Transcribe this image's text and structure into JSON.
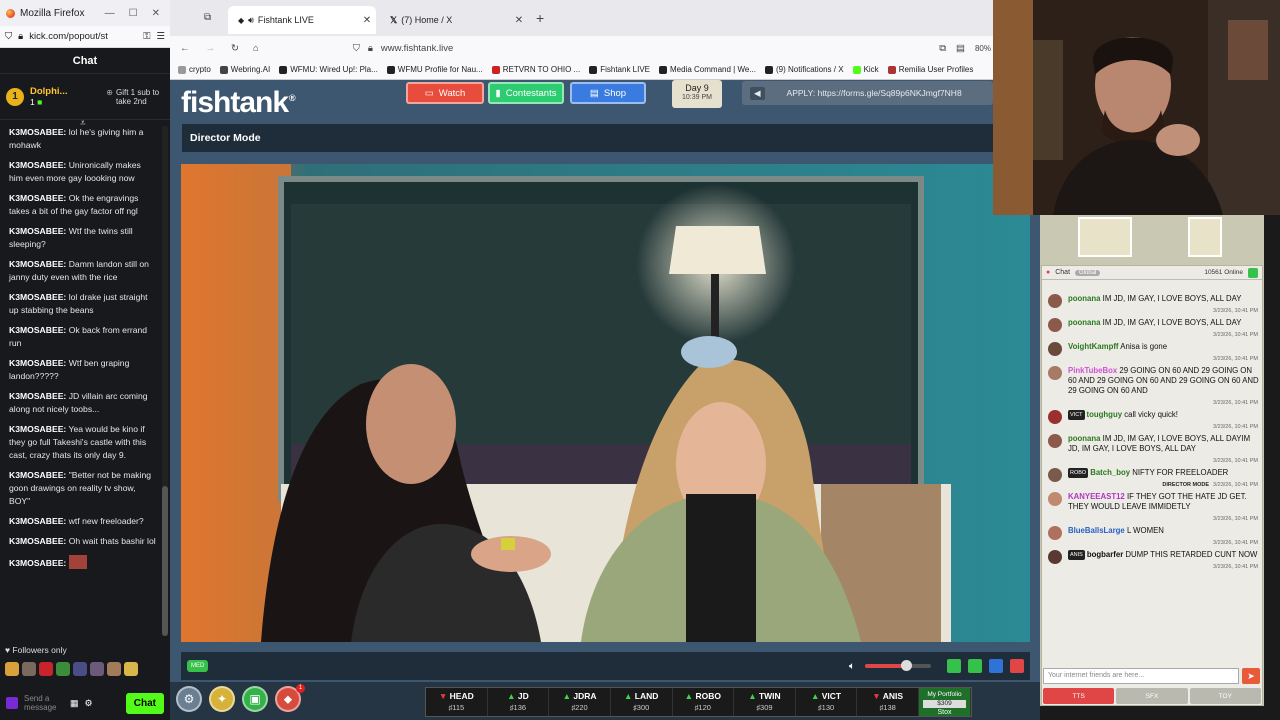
{
  "kick": {
    "window_title": "Mozilla Firefox",
    "url": "kick.com/popout/st",
    "chat_title": "Chat",
    "pinned": {
      "rank": "1",
      "name": "Dolphi...",
      "count": "1",
      "gift_text": "Gift 1 sub to take 2nd"
    },
    "messages": [
      {
        "user": "K3MOSABEE:",
        "text": "lol he's giving him a mohawk"
      },
      {
        "user": "K3MOSABEE:",
        "text": "Unironically makes him even more gay loooking now"
      },
      {
        "user": "K3MOSABEE:",
        "text": "Ok the engravings takes a bit of the gay factor off ngl"
      },
      {
        "user": "K3MOSABEE:",
        "text": "Wtf the twins still sleeping?"
      },
      {
        "user": "K3MOSABEE:",
        "text": "Damm landon still on janny duty even with the rice"
      },
      {
        "user": "K3MOSABEE:",
        "text": "lol drake just straight up stabbing the beans"
      },
      {
        "user": "K3MOSABEE:",
        "text": "Ok back from errand run"
      },
      {
        "user": "K3MOSABEE:",
        "text": "Wtf ben graping landon?????"
      },
      {
        "user": "K3MOSABEE:",
        "text": "JD villain arc coming along not nicely toobs..."
      },
      {
        "user": "K3MOSABEE:",
        "text": "Yea would be kino if they go full Takeshi's castle with this cast, crazy thats its only day 9."
      },
      {
        "user": "K3MOSABEE:",
        "text": "\"Better not be making goon drawings on reality tv show, BOY\""
      },
      {
        "user": "K3MOSABEE:",
        "text": "wtf new freeloader?"
      },
      {
        "user": "K3MOSABEE:",
        "text": "Oh wait thats bashir lol"
      },
      {
        "user": "K3MOSABEE:",
        "text": ""
      }
    ],
    "followers_only": "Followers only",
    "send_placeholder": "Send a message",
    "chat_button": "Chat"
  },
  "browser": {
    "tabs": [
      {
        "label": "Fishtank LIVE"
      },
      {
        "label": "(7) Home / X"
      }
    ],
    "new_tab": "+",
    "url": "www.fishtank.live",
    "zoom": "80%",
    "bookmarks": [
      "crypto",
      "Webring.AI",
      "WFMU: Wired Up!: Pla...",
      "WFMU Profile for Nau...",
      "RETVRN TO OHIO ...",
      "Fishtank LIVE",
      "Media Command | We...",
      "(9) Notifications / X",
      "Kick",
      "Remilia User Profiles"
    ]
  },
  "fishtank": {
    "logo": "fishtank",
    "logo_mark": "®",
    "nav": {
      "watch": "Watch",
      "contestants": "Contestants",
      "shop": "Shop"
    },
    "day": "Day 9",
    "time": "10:39 PM",
    "apply": "APPLY: https://forms.gle/Sq89p6NKJmgf7NH8",
    "director_mode": "Director Mode",
    "quality_badge": "MED",
    "volume_fraction": 0.62,
    "cams": [
      {
        "name": "HEAD",
        "count": "115",
        "trend": "down"
      },
      {
        "name": "JD",
        "count": "136",
        "trend": "up"
      },
      {
        "name": "JDRA",
        "count": "220",
        "trend": "up"
      },
      {
        "name": "LAND",
        "count": "300",
        "trend": "up"
      },
      {
        "name": "ROBO",
        "count": "120",
        "trend": "up"
      },
      {
        "name": "TWIN",
        "count": "309",
        "trend": "up"
      },
      {
        "name": "VICT",
        "count": "130",
        "trend": "up"
      },
      {
        "name": "ANIS",
        "count": "138",
        "trend": "down"
      }
    ],
    "portfolio": {
      "label": "My Portfolio",
      "value": "$309",
      "action": "Stox"
    },
    "notif_count": "1"
  },
  "right_chat": {
    "title": "Chat",
    "scope": "Global",
    "online": "10561 Online",
    "messages": [
      {
        "user": "poonana",
        "color": "#2a7a1d",
        "text": "IM JD, IM GAY, I LOVE BOYS, ALL DAY",
        "time": "3/23/26, 10:41 PM",
        "tag": ""
      },
      {
        "user": "poonana",
        "color": "#2a7a1d",
        "text": "IM JD, IM GAY, I LOVE BOYS, ALL DAY",
        "time": "3/23/26, 10:41 PM",
        "tag": ""
      },
      {
        "user": "VoightKampff",
        "color": "#2a7a1d",
        "text": "Anisa is gone",
        "time": "3/23/26, 10:41 PM",
        "tag": ""
      },
      {
        "user": "PinkTubeBox",
        "color": "#d24fd6",
        "text": "29 GOING ON 60 AND 29 GOING ON 60 AND 29 GOING ON 60 AND 29 GOING ON 60 AND 29 GOING ON 60 AND",
        "time": "3/23/26, 10:41 PM",
        "tag": ""
      },
      {
        "user": "toughguy",
        "color": "#2a7a1d",
        "text": "call vicky quick!",
        "time": "3/23/26, 10:41 PM",
        "tag": "VICT"
      },
      {
        "user": "poonana",
        "color": "#2a7a1d",
        "text": "IM JD, IM GAY, I LOVE BOYS, ALL DAYIM JD, IM GAY, I LOVE BOYS, ALL DAY",
        "time": "3/23/26, 10:41 PM",
        "tag": ""
      },
      {
        "user": "Batch_boy",
        "color": "#2a7a1d",
        "text": "NIFTY FOR FREELOADER",
        "time": "3/23/26, 10:41 PM",
        "tag": "ROBO",
        "note": "DIRECTOR MODE"
      },
      {
        "user": "KANYEEAST12",
        "color": "#b035c4",
        "text": "IF THEY GOT THE HATE JD GET. THEY WOULD LEAVE IMMIDETLY",
        "time": "3/23/26, 10:41 PM",
        "tag": ""
      },
      {
        "user": "BlueBallsLarge",
        "color": "#2860c4",
        "text": "L WOMEN",
        "time": "3/23/26, 10:41 PM",
        "tag": ""
      },
      {
        "user": "bogbarfer",
        "color": "#111111",
        "text": "DUMP THIS RETARDED CUNT NOW",
        "time": "3/23/26, 10:41 PM",
        "tag": "ANIS"
      }
    ],
    "input_placeholder": "Your internet friends are here...",
    "tabs": [
      "TTS",
      "SFX",
      "TOY"
    ]
  },
  "colors": {
    "accent_green": "#53fc18",
    "watch": "#e74c3c",
    "contestants": "#2ecc71",
    "shop": "#3a7be0"
  }
}
